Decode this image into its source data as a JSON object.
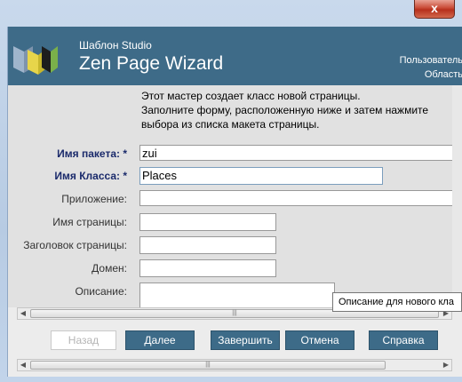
{
  "window": {
    "close_label": "x"
  },
  "banner": {
    "subtitle": "Шаблон Studio",
    "title": "Zen Page Wizard",
    "right_line1": "Пользователь",
    "right_line2": "Область"
  },
  "intro": {
    "line1": "Этот мастер создает класс новой страницы.",
    "line2": "Заполните форму, расположенную ниже и затем нажмите",
    "line3": "выбора из списка макета страницы."
  },
  "fields": {
    "package": {
      "label": "Имя пакета: *",
      "value": "zui"
    },
    "class": {
      "label": "Имя Класса: *",
      "value": "Places"
    },
    "application": {
      "label": "Приложение:",
      "value": ""
    },
    "page_name": {
      "label": "Имя страницы:",
      "value": ""
    },
    "page_title": {
      "label": "Заголовок страницы:",
      "value": ""
    },
    "domain": {
      "label": "Домен:",
      "value": ""
    },
    "description": {
      "label": "Описание:",
      "value": ""
    }
  },
  "tooltip": {
    "text": "Описание для нового кла"
  },
  "buttons": {
    "back": "Назад",
    "next": "Далее",
    "finish": "Завершить",
    "cancel": "Отмена",
    "help": "Справка"
  },
  "colors": {
    "banner": "#3e6b88",
    "button": "#3d6b88",
    "required_label": "#1a2a6b"
  }
}
